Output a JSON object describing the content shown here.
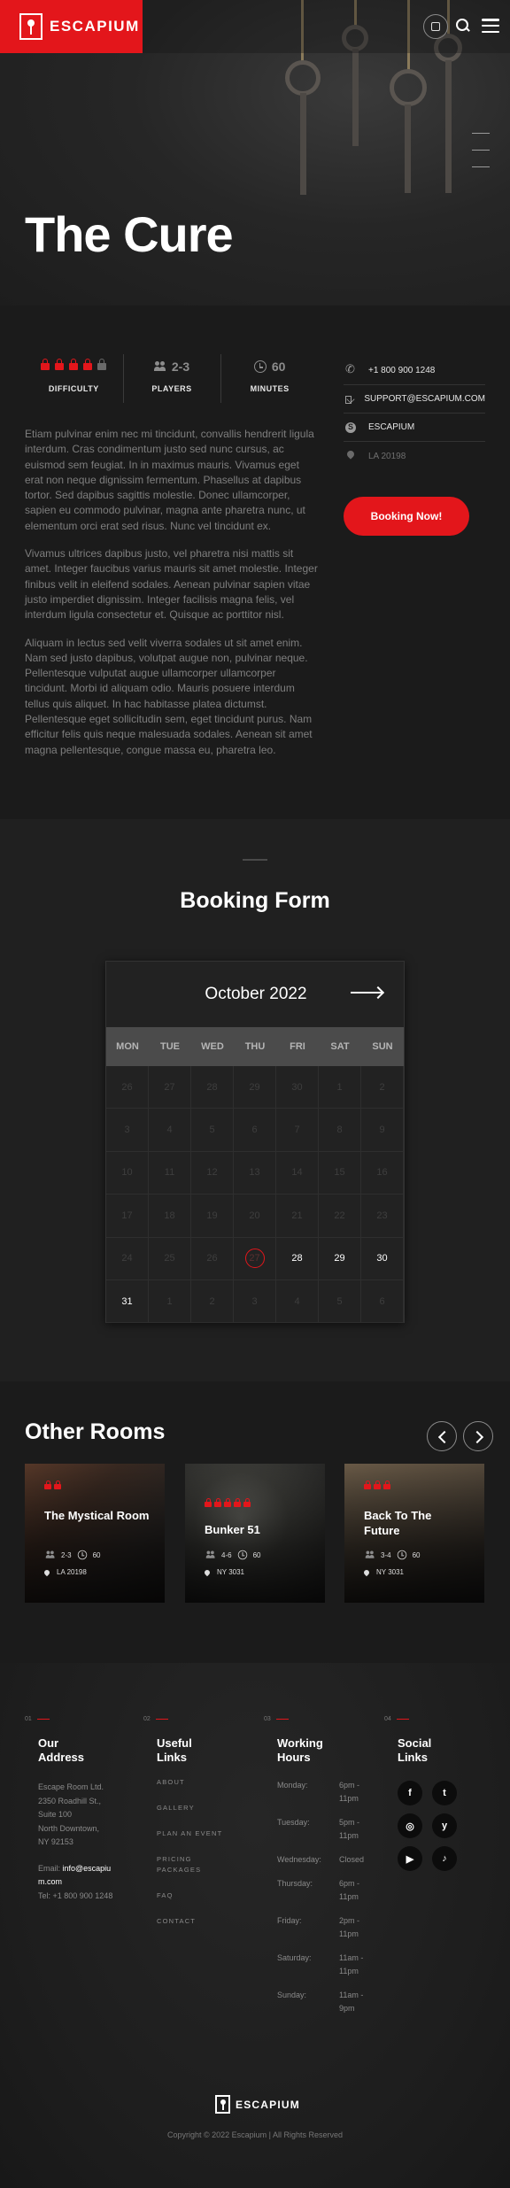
{
  "header": {
    "logo": "ESCAPIUM"
  },
  "hero": {
    "title": "The Cure"
  },
  "stats": {
    "difficulty": {
      "label": "DIFFICULTY",
      "rating": 4,
      "max": 5
    },
    "players": {
      "label": "PLAYERS",
      "value": "2-3"
    },
    "minutes": {
      "label": "MINUTES",
      "value": "60"
    }
  },
  "description": [
    "Etiam pulvinar enim nec mi tincidunt, convallis hendrerit ligula interdum. Cras condimentum justo sed nunc cursus, ac euismod sem feugiat. In in maximus mauris. Vivamus eget erat non neque dignissim fermentum. Phasellus at dapibus tortor. Sed dapibus sagittis molestie. Donec ullamcorper, sapien eu commodo pulvinar, magna ante pharetra nunc, ut elementum orci erat sed risus. Nunc vel tincidunt ex.",
    "Vivamus ultrices dapibus justo, vel pharetra nisi mattis sit amet. Integer faucibus varius mauris sit amet molestie. Integer finibus velit in eleifend sodales. Aenean pulvinar sapien vitae justo imperdiet dignissim. Integer facilisis magna felis, vel interdum ligula consectetur et. Quisque ac porttitor nisl.",
    "Aliquam in lectus sed velit viverra sodales ut sit amet enim. Nam sed justo dapibus, volutpat augue non, pulvinar neque. Pellentesque vulputat augue ullamcorper ullamcorper tincidunt. Morbi id aliquam odio. Mauris posuere interdum tellus quis aliquet. In hac habitasse platea dictumst. Pellentesque eget sollicitudin sem, eget tincidunt purus. Nam efficitur felis quis neque malesuada sodales. Aenean sit amet magna pellentesque, congue massa eu, pharetra leo."
  ],
  "contact": {
    "phone": "+1 800 900 1248",
    "email": "SUPPORT@ESCAPIUM.COM",
    "skype": "ESCAPIUM",
    "location": "LA 20198"
  },
  "booking_button": "Booking Now!",
  "booking": {
    "title": "Booking Form",
    "month": "October 2022",
    "weekdays": [
      "MON",
      "TUE",
      "WED",
      "THU",
      "FRI",
      "SAT",
      "SUN"
    ],
    "cells": [
      "26",
      "27",
      "28",
      "29",
      "30",
      "1",
      "2",
      "3",
      "4",
      "5",
      "6",
      "7",
      "8",
      "9",
      "10",
      "11",
      "12",
      "13",
      "14",
      "15",
      "16",
      "17",
      "18",
      "19",
      "20",
      "21",
      "22",
      "23",
      "24",
      "25",
      "26",
      "27",
      "28",
      "29",
      "30",
      "31",
      "1",
      "2",
      "3",
      "4",
      "5",
      "6"
    ],
    "available": [
      32,
      33,
      34,
      35
    ],
    "today_index": 31
  },
  "rooms": {
    "title": "Other Rooms",
    "items": [
      {
        "name": "The Mystical Room",
        "difficulty": 2,
        "players": "2-3",
        "minutes": "60",
        "location": "LA 20198"
      },
      {
        "name": "Bunker 51",
        "difficulty": 5,
        "players": "4-6",
        "minutes": "60",
        "location": "NY 3031"
      },
      {
        "name": "Back To The Future",
        "difficulty": 3,
        "players": "3-4",
        "minutes": "60",
        "location": "NY 3031"
      }
    ]
  },
  "footer": {
    "address": {
      "num": "01",
      "title": "Our Address",
      "lines": [
        "Escape Room Ltd.",
        "2350 Roadhill St.,",
        "Suite 100",
        "North Downtown,",
        "NY 92153"
      ],
      "email_label": "Email: ",
      "email": "info@escapium.com",
      "tel": "Tel: +1 800 900 1248"
    },
    "links": {
      "num": "02",
      "title": "Useful Links",
      "items": [
        "ABOUT",
        "GALLERY",
        "PLAN AN EVENT",
        "PRICING PACKAGES",
        "FAQ",
        "CONTACT"
      ]
    },
    "hours": {
      "num": "03",
      "title": "Working Hours",
      "rows": [
        {
          "day": "Monday:",
          "time": "6pm - 11pm"
        },
        {
          "day": "Tuesday:",
          "time": "5pm - 11pm"
        },
        {
          "day": "Wednesday:",
          "time": "Closed"
        },
        {
          "day": "Thursday:",
          "time": "6pm - 11pm"
        },
        {
          "day": "Friday:",
          "time": "2pm - 11pm"
        },
        {
          "day": "Saturday:",
          "time": "11am - 11pm"
        },
        {
          "day": "Sunday:",
          "time": "11am - 9pm"
        }
      ]
    },
    "social": {
      "num": "04",
      "title": "Social Links",
      "icons": [
        "facebook-icon",
        "twitter-icon",
        "instagram-icon",
        "yelp-icon",
        "youtube-icon",
        "tiktok-icon"
      ],
      "glyphs": [
        "f",
        "t",
        "◎",
        "y",
        "▶",
        "♪"
      ]
    },
    "logo": "ESCAPIUM",
    "copyright": "Copyright © 2022 Escapium | All Rights Reserved"
  },
  "colors": {
    "accent": "#e3161b",
    "background": "#1b1b1b"
  }
}
